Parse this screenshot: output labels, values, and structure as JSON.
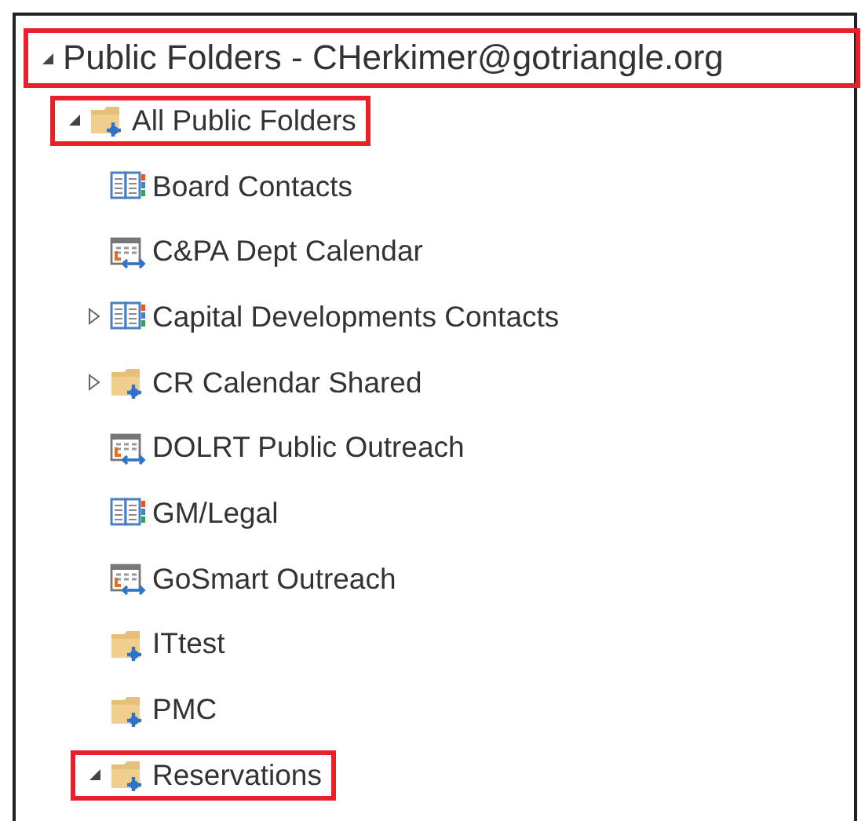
{
  "tree": {
    "label": "Public Folders - CHerkimer@gotriangle.org",
    "expanded": true,
    "highlighted": true,
    "children": [
      {
        "label": "All Public Folders",
        "kind": "folder",
        "expanded": true,
        "highlighted": true,
        "children": [
          {
            "label": "Board Contacts",
            "kind": "contacts",
            "highlighted": false
          },
          {
            "label": "C&PA Dept Calendar",
            "kind": "calendar",
            "highlighted": false
          },
          {
            "label": "Capital Developments Contacts",
            "kind": "contacts",
            "expanded": false,
            "highlighted": false
          },
          {
            "label": "CR Calendar Shared",
            "kind": "folder",
            "expanded": false,
            "highlighted": false
          },
          {
            "label": "DOLRT Public Outreach",
            "kind": "calendar",
            "highlighted": false
          },
          {
            "label": "GM/Legal",
            "kind": "contacts",
            "highlighted": false
          },
          {
            "label": "GoSmart Outreach",
            "kind": "calendar",
            "highlighted": false
          },
          {
            "label": "ITtest",
            "kind": "folder",
            "highlighted": false
          },
          {
            "label": "PMC",
            "kind": "folder",
            "highlighted": false
          },
          {
            "label": "Reservations",
            "kind": "folder",
            "expanded": true,
            "highlighted": true
          }
        ]
      }
    ]
  }
}
